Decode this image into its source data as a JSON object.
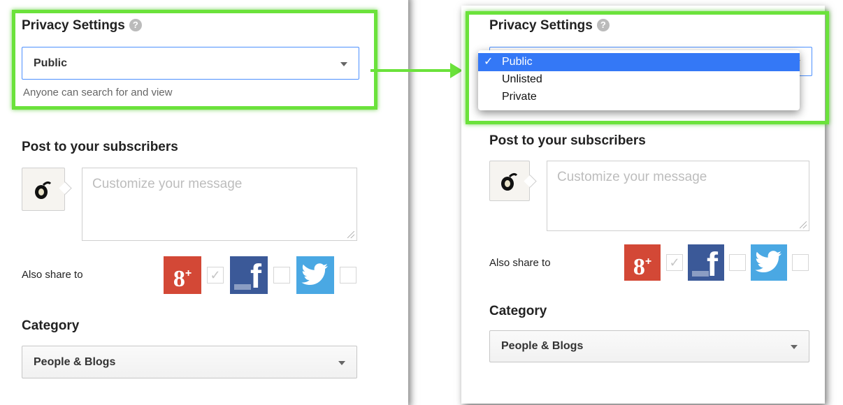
{
  "privacy": {
    "heading": "Privacy Settings",
    "help_glyph": "?",
    "selected": "Public",
    "hint": "Anyone can search for and view",
    "options": [
      "Public",
      "Unlisted",
      "Private"
    ],
    "check_glyph": "✓"
  },
  "subscribers": {
    "heading": "Post to your subscribers",
    "placeholder": "Customize your message"
  },
  "share": {
    "label": "Also share to",
    "services": [
      {
        "name": "google-plus",
        "glyph": "8",
        "sup": "+",
        "checked": true,
        "check_glyph": "✓",
        "color": "#d34836"
      },
      {
        "name": "facebook",
        "glyph": "f",
        "checked": false,
        "color": "#3b5998"
      },
      {
        "name": "twitter",
        "checked": false,
        "color": "#4aa8e3"
      }
    ]
  },
  "category": {
    "heading": "Category",
    "selected": "People & Blogs"
  },
  "colors": {
    "highlight": "#6be23b",
    "menu_selected": "#3478f6"
  }
}
